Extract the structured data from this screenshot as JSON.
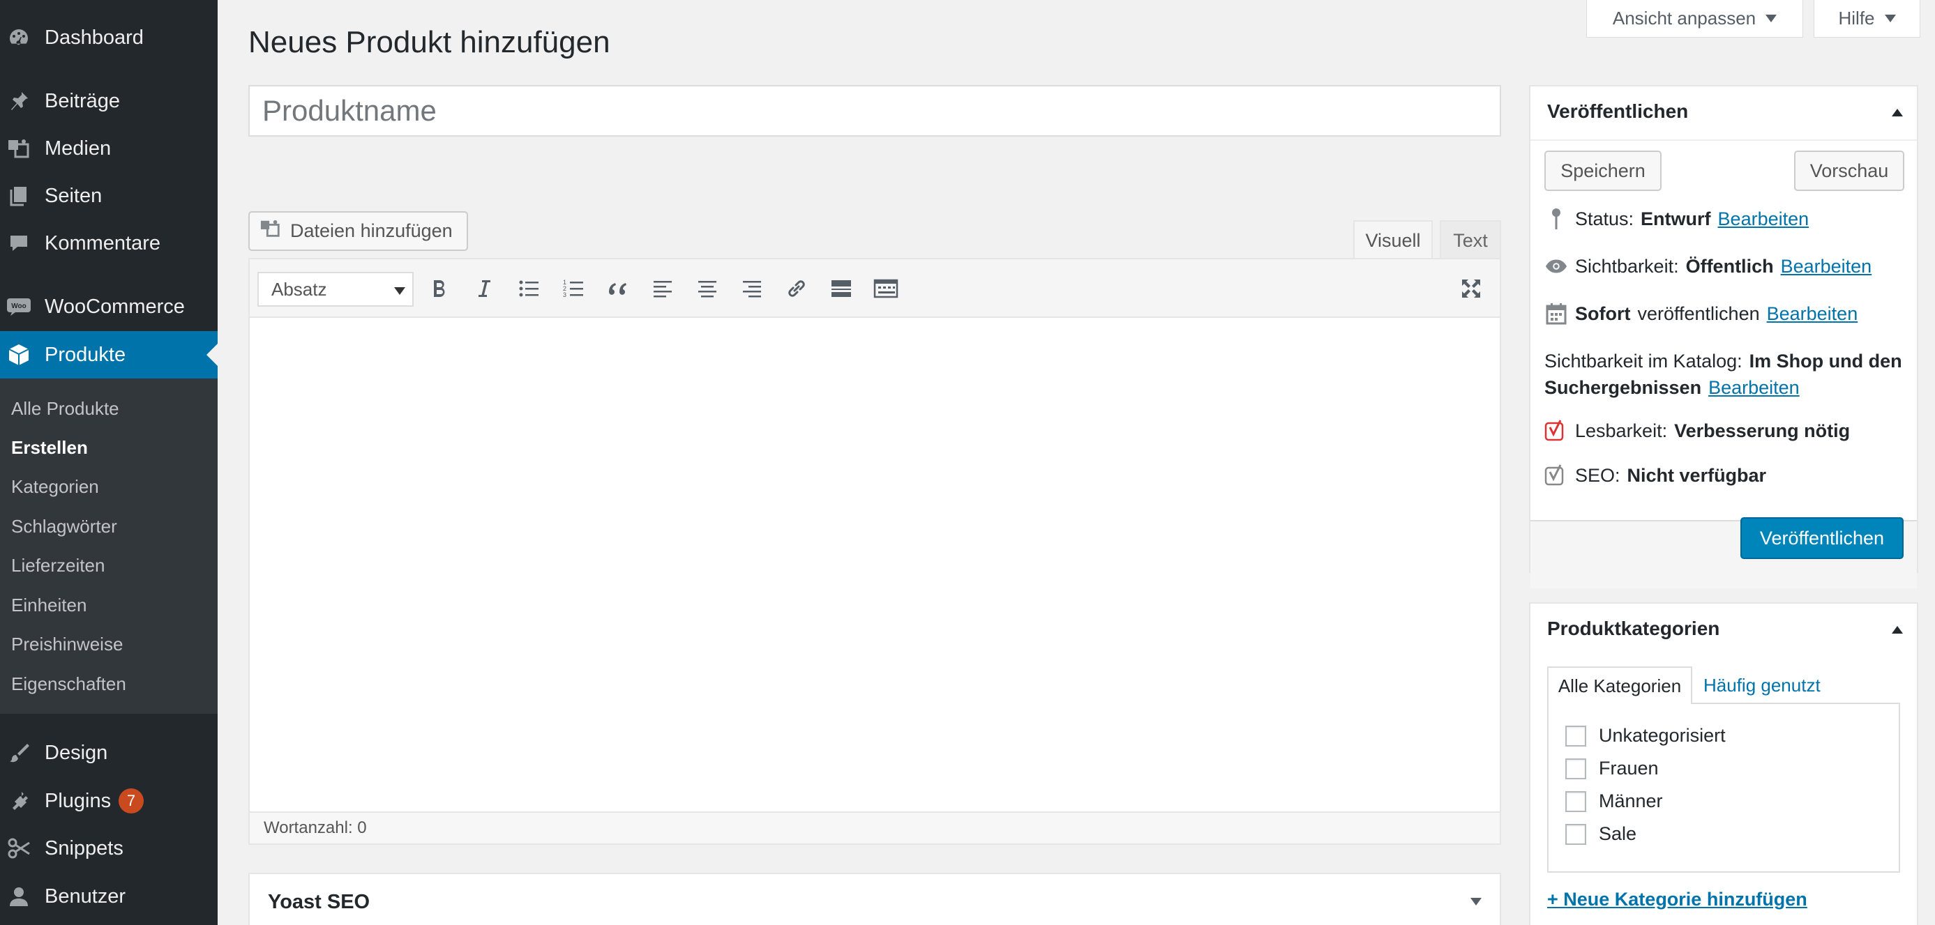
{
  "sidebar": {
    "items": [
      {
        "label": "Dashboard",
        "icon": "dashboard-icon"
      },
      {
        "label": "Beiträge",
        "icon": "pin-icon"
      },
      {
        "label": "Medien",
        "icon": "media-icon"
      },
      {
        "label": "Seiten",
        "icon": "pages-icon"
      },
      {
        "label": "Kommentare",
        "icon": "comment-icon"
      },
      {
        "label": "WooCommerce",
        "icon": "woocommerce-icon"
      },
      {
        "label": "Produkte",
        "icon": "product-box-icon"
      },
      {
        "label": "Design",
        "icon": "brush-icon"
      },
      {
        "label": "Plugins",
        "icon": "plugin-icon",
        "badge": "7"
      },
      {
        "label": "Snippets",
        "icon": "scissors-icon"
      },
      {
        "label": "Benutzer",
        "icon": "user-icon"
      }
    ],
    "submenu": [
      "Alle Produkte",
      "Erstellen",
      "Kategorien",
      "Schlagwörter",
      "Lieferzeiten",
      "Einheiten",
      "Preishinweise",
      "Eigenschaften"
    ],
    "woo_logo_text": "Woo"
  },
  "screen_meta": {
    "options_label": "Ansicht anpassen",
    "help_label": "Hilfe"
  },
  "page_title": "Neues Produkt hinzufügen",
  "title_field": {
    "placeholder": "Produktname",
    "value": ""
  },
  "editor": {
    "add_media_label": "Dateien hinzufügen",
    "tab_visual": "Visuell",
    "tab_text": "Text",
    "format_select": "Absatz",
    "word_count": "Wortanzahl: 0"
  },
  "yoast": {
    "title": "Yoast SEO"
  },
  "publish": {
    "title": "Veröffentlichen",
    "save_label": "Speichern",
    "preview_label": "Vorschau",
    "status_label": "Status:",
    "status_value": "Entwurf",
    "visibility_label": "Sichtbarkeit:",
    "visibility_value": "Öffentlich",
    "schedule_value": "Sofort",
    "schedule_label": "veröffentlichen",
    "catalog_label": "Sichtbarkeit im Katalog:",
    "catalog_value_1": "Im Shop und den",
    "catalog_value_2": "Suchergebnissen",
    "readability_label": "Lesbarkeit:",
    "readability_value": "Verbesserung nötig",
    "seo_label": "SEO:",
    "seo_value": "Nicht verfügbar",
    "edit_link": "Bearbeiten",
    "publish_button": "Veröffentlichen"
  },
  "categories": {
    "title": "Produktkategorien",
    "tab_all": "Alle Kategorien",
    "tab_popular": "Häufig genutzt",
    "items": [
      "Unkategorisiert",
      "Frauen",
      "Männer",
      "Sale"
    ],
    "add_link": "+ Neue Kategorie hinzufügen"
  },
  "colors": {
    "sidebar_bg": "#23282d",
    "accent": "#0073aa",
    "publish_button": "#0085ba",
    "badge": "#ca4a1f"
  }
}
